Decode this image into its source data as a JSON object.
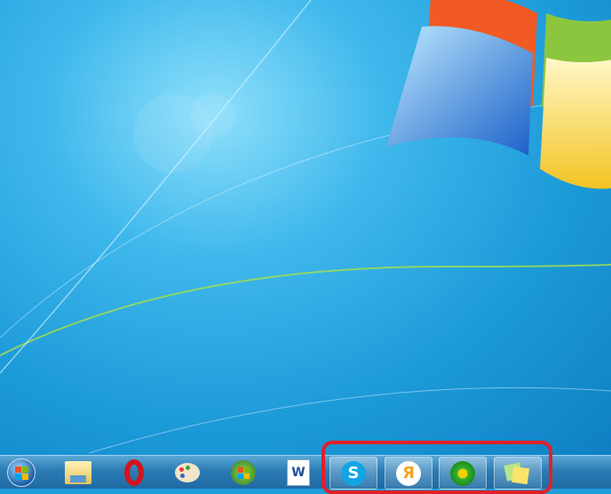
{
  "taskbar": {
    "start": {
      "icon": "windows-start-orb"
    },
    "pinned_left": [
      {
        "name": "windows-explorer",
        "icon": "folder-icon"
      },
      {
        "name": "opera",
        "icon": "opera-icon"
      },
      {
        "name": "paint",
        "icon": "palette-icon"
      },
      {
        "name": "media-center",
        "icon": "windows-media-icon"
      },
      {
        "name": "word",
        "icon": "word-icon",
        "glyph": "W"
      }
    ],
    "highlighted": [
      {
        "name": "skype",
        "icon": "skype-icon",
        "glyph": "S"
      },
      {
        "name": "yandex",
        "icon": "yandex-icon",
        "glyph": "Я"
      },
      {
        "name": "icq",
        "icon": "icq-flower-icon"
      },
      {
        "name": "sticky-notes",
        "icon": "sticky-notes-icon"
      }
    ]
  },
  "colors": {
    "highlight": "#e0202a",
    "taskbar": "#2b7bb4"
  }
}
